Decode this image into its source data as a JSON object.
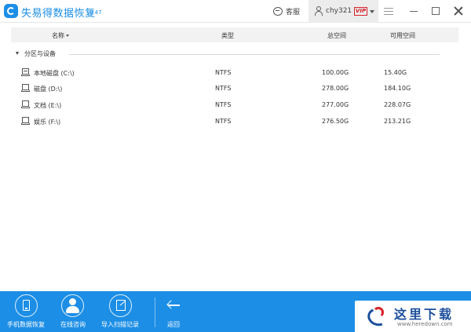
{
  "app": {
    "title": "失易得数据恢复",
    "version": "6.47"
  },
  "header": {
    "service_label": "客服",
    "username": "chy321",
    "vip_label": "VIP"
  },
  "table": {
    "columns": {
      "name": "名称",
      "type": "类型",
      "total": "总空间",
      "free": "可用空间"
    },
    "group_label": "分区与设备",
    "rows": [
      {
        "name": "本地磁盘 (C:\\)",
        "type": "NTFS",
        "total": "100.00G",
        "free": "15.40G",
        "icon": "system-drive-icon"
      },
      {
        "name": "磁盘 (D:\\)",
        "type": "NTFS",
        "total": "278.00G",
        "free": "184.10G",
        "icon": "drive-icon"
      },
      {
        "name": "文档 (E:\\)",
        "type": "NTFS",
        "total": "277.00G",
        "free": "228.07G",
        "icon": "drive-icon"
      },
      {
        "name": "娱乐 (F:\\)",
        "type": "NTFS",
        "total": "276.50G",
        "free": "213.21G",
        "icon": "drive-icon"
      }
    ]
  },
  "toolbar": {
    "phone_recovery_label": "手机数据恢复",
    "online_consult_label": "在线咨询",
    "import_scan_label": "导入扫描记录",
    "back_label": "返回"
  },
  "watermark": {
    "text": "这里下载",
    "url": "www.heredown.com"
  },
  "colors": {
    "accent": "#1c8ee6",
    "vip": "#d8232a",
    "header_bg": "#f2f2f2"
  }
}
